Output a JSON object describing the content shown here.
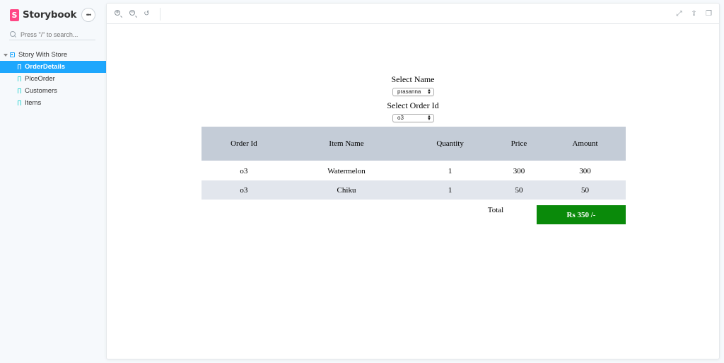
{
  "sidebar": {
    "brand": "Storybook",
    "menu_label": "•••",
    "search_placeholder": "Press \"/\" to search...",
    "group": "Story With Store",
    "items": [
      {
        "label": "OrderDetails",
        "active": true
      },
      {
        "label": "PlceOrder",
        "active": false
      },
      {
        "label": "Customers",
        "active": false
      },
      {
        "label": "Items",
        "active": false
      }
    ]
  },
  "toolbar": {
    "zoom_in": "zoom-in-icon",
    "zoom_out": "zoom-out-icon",
    "reset": "reset-zoom-icon",
    "fullscreen": "fullscreen-icon",
    "share": "share-icon",
    "copy": "copy-icon"
  },
  "form": {
    "name_label": "Select Name",
    "name_value": "prasanna",
    "order_label": "Select Order Id",
    "order_value": "o3"
  },
  "table": {
    "headers": [
      "Order Id",
      "Item Name",
      "Quantity",
      "Price",
      "Amount"
    ],
    "rows": [
      [
        "o3",
        "Watermelon",
        "1",
        "300",
        "300"
      ],
      [
        "o3",
        "Chiku",
        "1",
        "50",
        "50"
      ]
    ]
  },
  "total": {
    "label": "Total",
    "value": "Rs 350 /-"
  },
  "colors": {
    "accent": "#1ea7fd",
    "brand": "#ff4785",
    "header_bg": "#c4ccd7",
    "total_bg": "#0a8a0a"
  }
}
